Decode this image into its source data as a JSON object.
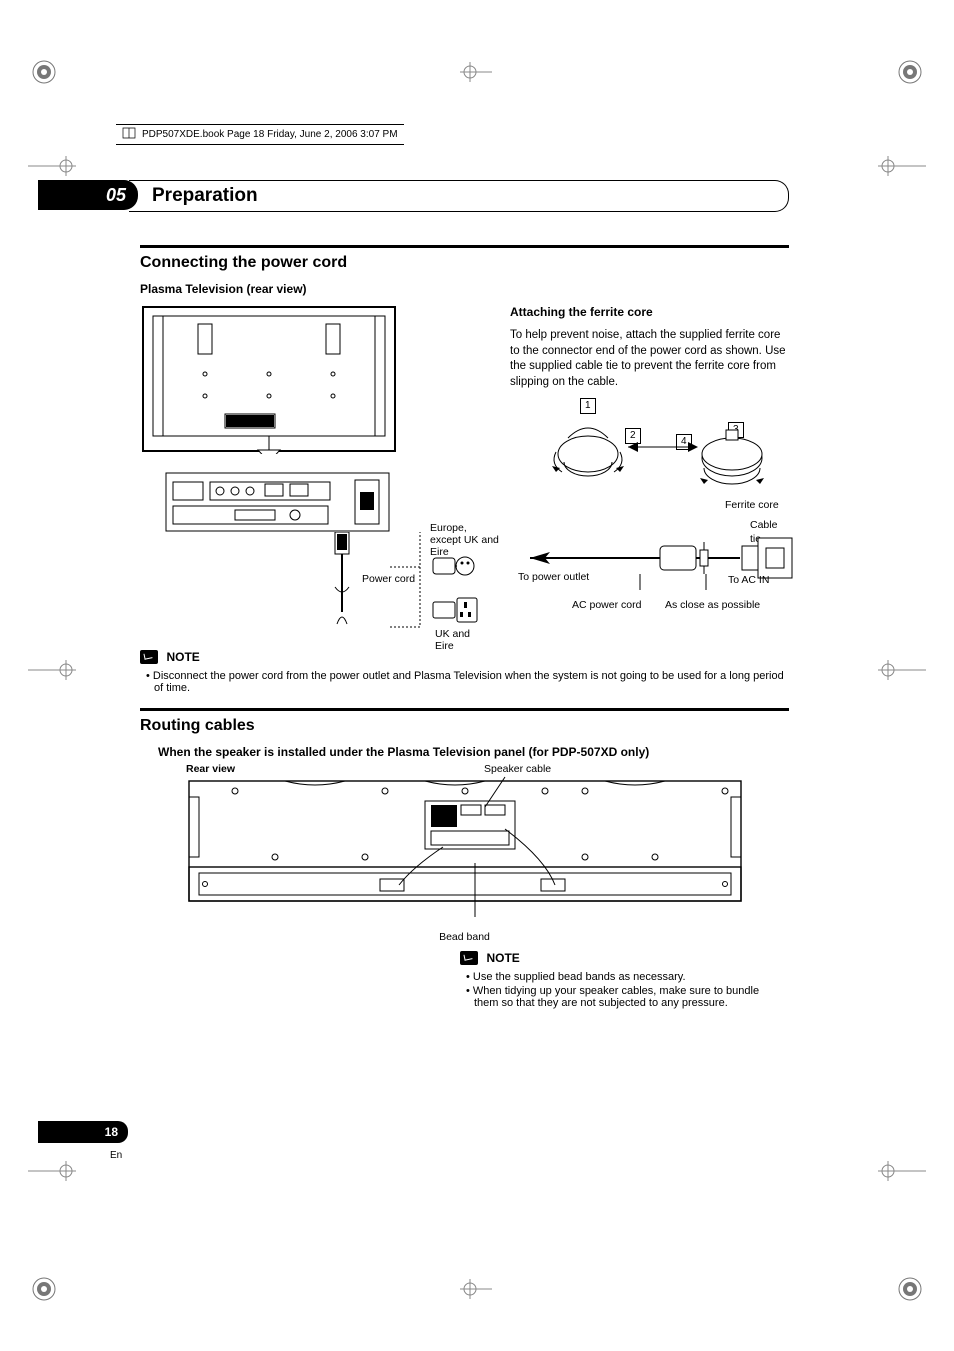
{
  "file_header": "PDP507XDE.book  Page 18  Friday, June 2, 2006  3:07 PM",
  "chapter_number": "05",
  "chapter_title": "Preparation",
  "section1_title": "Connecting the power cord",
  "plasma_heading": "Plasma Television (rear view)",
  "ferrite_heading": "Attaching the ferrite core",
  "ferrite_body": "To help prevent noise, attach the supplied ferrite core to the connector end of the power cord as shown. Use the supplied cable tie to prevent the ferrite core from slipping on the cable.",
  "callouts": {
    "power_cord": "Power cord",
    "europe": "Europe, except UK and Eire",
    "uk_eire": "UK and Eire",
    "ferrite_core": "Ferrite core",
    "cable_tie": "Cable tie",
    "to_ac_in": "To AC IN",
    "close": "As close as possible",
    "ac_power_cord": "AC power cord",
    "to_power_outlet": "To power outlet",
    "n1": "1",
    "n2": "2",
    "n3": "3",
    "n4": "4"
  },
  "note_label": "NOTE",
  "note1_bullet": "Disconnect the power cord from the power outlet and Plasma Television when the system is not going to be used for a long period of time.",
  "section2_title": "Routing cables",
  "routing_sub": "When the speaker is installed under the Plasma Television panel (for PDP-507XD only)",
  "routing_rear_view": "Rear view",
  "routing_speaker_cable": "Speaker cable",
  "routing_bead_band": "Bead band",
  "note2_bullets": [
    "Use the supplied bead bands as necessary.",
    "When tidying up your speaker cables, make sure to bundle them so that they are not subjected to any pressure."
  ],
  "page_number": "18",
  "page_lang": "En"
}
